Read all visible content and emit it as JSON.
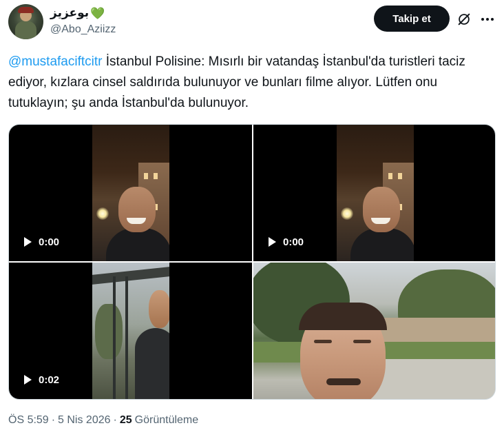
{
  "author": {
    "display_name": "بوعزيز",
    "display_emoji": "💚",
    "handle": "@Abo_Aziizz"
  },
  "actions": {
    "follow_label": "Takip et"
  },
  "tweet": {
    "mention": "@mustafaciftcitr",
    "text": " İstanbul Polisine: Mısırlı bir vatandaş İstanbul'da turistleri taciz ediyor, kızlara cinsel saldırıda bulunuyor ve bunları filme alıyor. Lütfen onu tutuklayın; şu anda İstanbul'da bulunuyor."
  },
  "media": [
    {
      "type": "video",
      "duration": "0:00"
    },
    {
      "type": "video",
      "duration": "0:00"
    },
    {
      "type": "video",
      "duration": "0:02"
    },
    {
      "type": "photo"
    }
  ],
  "meta": {
    "time": "ÖS 5:59",
    "separator": "·",
    "date": "5 Nis 2026",
    "views_count": "25",
    "views_label": "Görüntüleme"
  },
  "colors": {
    "link": "#1d9bf0",
    "heart": "#5cc85c",
    "follow_bg": "#0f1419"
  },
  "icons": [
    "grok-icon",
    "more-icon",
    "play-icon"
  ]
}
